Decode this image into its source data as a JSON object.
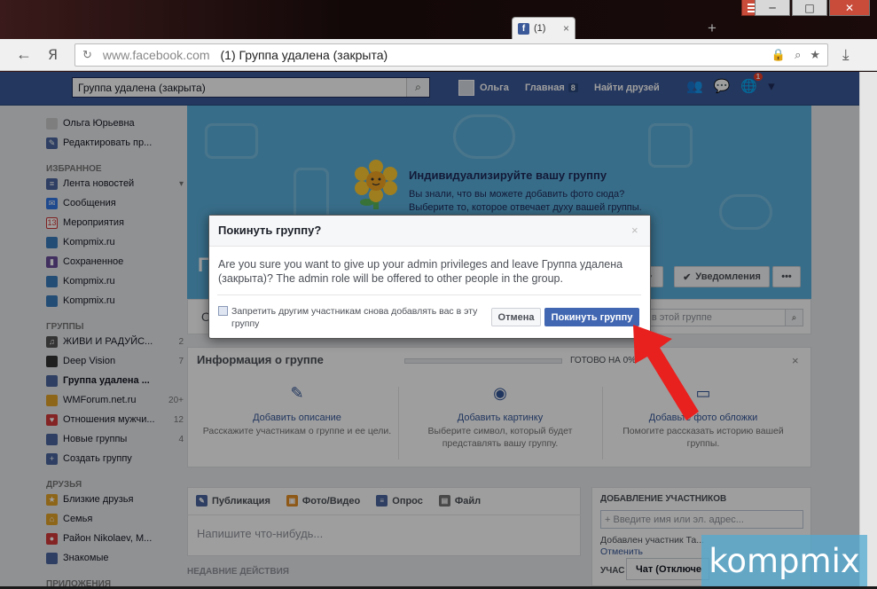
{
  "browser": {
    "tab_title": "(1)",
    "tab_close": "×",
    "new_tab": "+",
    "url_host": "www.facebook.com",
    "url_title": "(1) Группа удалена (закрыта)",
    "yandex": "Я",
    "back": "←",
    "reload": "↻",
    "download": "⤓"
  },
  "window": {
    "minimize": "─",
    "maximize": "□",
    "close": "✕"
  },
  "fb": {
    "search_value": "Группа удалена (закрыта)",
    "user_name": "Ольга",
    "home_label": "Главная",
    "home_count": "8",
    "find_friends": "Найти друзей",
    "notif_badge": "1"
  },
  "sidebar": {
    "profile_name": "Ольга Юрьевна",
    "edit_profile": "Редактировать пр...",
    "favorites_head": "ИЗБРАННОЕ",
    "favorites": [
      {
        "label": "Лента новостей",
        "count": "▾"
      },
      {
        "label": "Сообщения",
        "count": ""
      },
      {
        "label": "Мероприятия",
        "count": ""
      },
      {
        "label": "Kompmix.ru",
        "count": ""
      },
      {
        "label": "Сохраненное",
        "count": ""
      },
      {
        "label": "Kompmix.ru",
        "count": ""
      },
      {
        "label": "Kompmix.ru",
        "count": ""
      }
    ],
    "groups_head": "ГРУППЫ",
    "groups": [
      {
        "label": "ЖИВИ И РАДУЙС...",
        "count": "2"
      },
      {
        "label": "Deep Vision",
        "count": "7"
      },
      {
        "label": "Группа удалена ...",
        "count": ""
      },
      {
        "label": "WMForum.net.ru",
        "count": "20+"
      },
      {
        "label": "Отношения мужчи...",
        "count": "12"
      },
      {
        "label": "Новые группы",
        "count": "4"
      },
      {
        "label": "Создать группу",
        "count": ""
      }
    ],
    "friends_head": "ДРУЗЬЯ",
    "friends": [
      {
        "label": "Близкие друзья"
      },
      {
        "label": "Семья"
      },
      {
        "label": "Район Nikolaev, M..."
      },
      {
        "label": "Знакомые"
      }
    ],
    "apps_head": "ПРИЛОЖЕНИЯ"
  },
  "cover": {
    "title": "Индивидуализируйте вашу группу",
    "text": "Вы знали, что вы можете добавить фото сюда? Выберите то, которое отвечает духу вашей группы.",
    "letter": "Г",
    "notifications_btn": "Уведомления",
    "more_btn": "•••",
    "join_btn": "▾"
  },
  "tabs": {
    "first_letter": "О",
    "search_placeholder": "к в этой группе"
  },
  "info": {
    "title": "Информация о группе",
    "ready": "ГОТОВО НА 0%",
    "progress": 0,
    "close": "×",
    "cells": [
      {
        "link": "Добавить описание",
        "text": "Расскажите участникам о группе и ее цели."
      },
      {
        "link": "Добавить картинку",
        "text": "Выберите символ, который будет представлять вашу группу."
      },
      {
        "link": "Добавьте фото обложки",
        "text": "Помогите рассказать историю вашей группы."
      }
    ]
  },
  "composer": {
    "tabs": [
      "Публикация",
      "Фото/Видео",
      "Опрос",
      "Файл"
    ],
    "placeholder": "Напишите что-нибудь...",
    "recent": "НЕДАВНИЕ ДЕЙСТВИЯ"
  },
  "add_members": {
    "title": "ДОБАВЛЕНИЕ УЧАСТНИКОВ",
    "placeholder": "+ Введите имя или эл. адрес...",
    "added": "Добавлен участник Та...",
    "cancel": "Отменить",
    "members_head": "УЧАС"
  },
  "chat": {
    "label": "Чат (Отключе"
  },
  "dialog": {
    "title": "Покинуть группу?",
    "close": "×",
    "body": "Are you sure you want to give up your admin privileges and leave Группа удалена (закрыта)? The admin role will be offered to other people in the group.",
    "checkbox_label": "Запретить другим участникам снова добавлять вас в эту группу",
    "cancel": "Отмена",
    "leave": "Покинуть группу"
  },
  "watermark": "kompmix",
  "colors": {
    "fb_blue": "#3b5998",
    "button_blue": "#4267b2",
    "arrow_red": "#e8201e",
    "cover_blue": "#5bb0dd"
  }
}
